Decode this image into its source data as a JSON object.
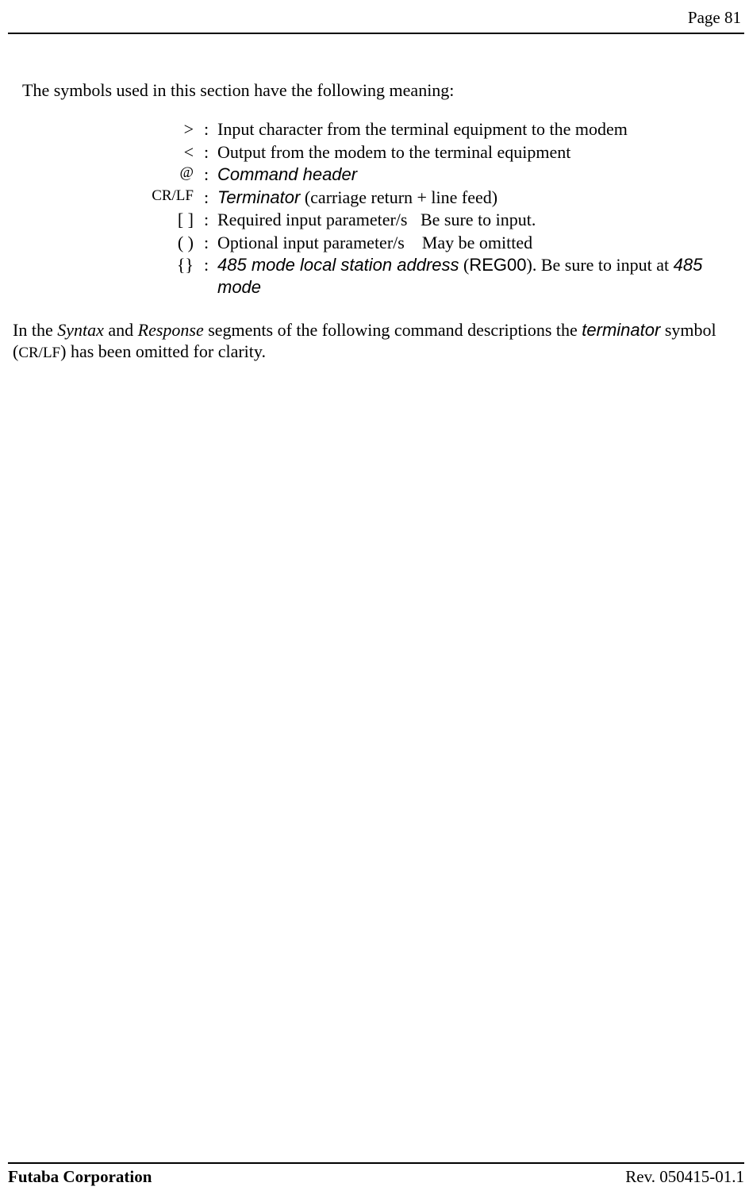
{
  "header": {
    "page_label": "Page  81"
  },
  "intro": "The symbols used in this section have the following meaning:",
  "symbols": [
    {
      "sym": ">",
      "small": false,
      "desc_html": "Input character from the terminal equipment to the modem"
    },
    {
      "sym": "<",
      "small": false,
      "desc_html": "Output from the modem to the terminal equipment"
    },
    {
      "sym": "@",
      "small": true,
      "desc_html": "<span class='arialit'>Command header</span>"
    },
    {
      "sym": "CR/LF",
      "small": true,
      "desc_html": "<span class='arialit'>Terminator</span> (carriage return + line feed)"
    },
    {
      "sym": "[ ]",
      "small": false,
      "desc_html": "Required input parameter/s&nbsp;&nbsp; Be sure to input."
    },
    {
      "sym": "( )",
      "small": false,
      "desc_html": "Optional input parameter/s&nbsp;&nbsp;&nbsp; May be omitted"
    },
    {
      "sym": "{}",
      "small": false,
      "desc_html": "<span class='arialit'>485 mode local station address</span> (<span class='arial'>REG00</span>). Be sure to input at <span class='arialit'>485 mode</span>"
    }
  ],
  "closing_html": "In the <span class='tnrit'>Syntax</span> and <span class='tnrit'>Response</span> segments of the following command descriptions the <span class='arialit'>terminator</span> symbol (<span class='smallcaps'>CR/LF</span>) has been omitted for clarity.",
  "footer": {
    "company": "Futaba Corporation",
    "rev": "Rev. 050415-01.1"
  }
}
